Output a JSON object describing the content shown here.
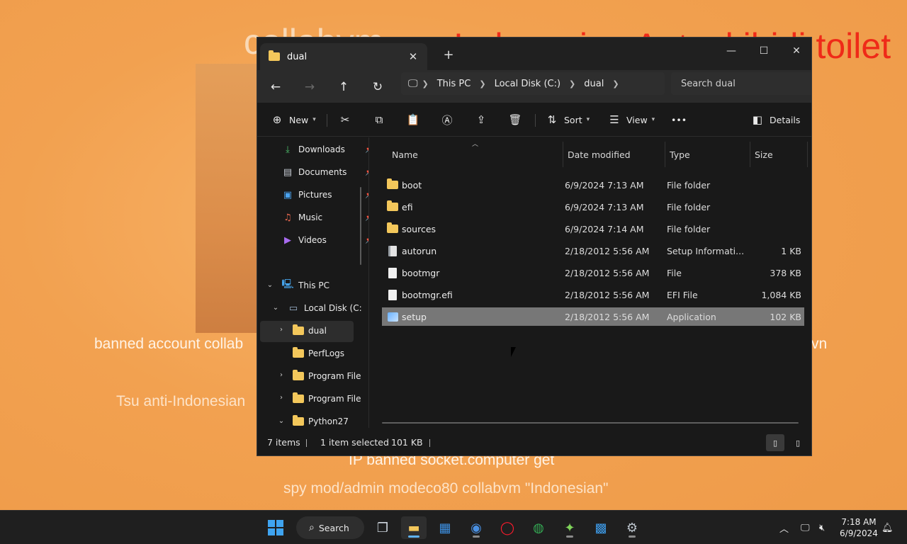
{
  "wallpaper": {
    "collabvm": "collabvm",
    "red_text": "Indonesian Autoskibidi toilet",
    "banned_line": "banned account collab",
    "vn_fragment": "vn",
    "tsu_line": "Tsu anti-Indonesian",
    "ip_line": "IP banned socket.computer get",
    "spy_line": "spy mod/admin modeco80 collabvm \"Indonesian\""
  },
  "window": {
    "tab_title": "dual",
    "tab_close": "✕",
    "new_tab": "+",
    "minimize": "—",
    "maximize": "☐",
    "close": "✕"
  },
  "nav": {
    "back": "←",
    "forward": "→",
    "up": "↑",
    "refresh": "↻",
    "breadcrumbs": [
      "This PC",
      "Local Disk (C:)",
      "dual"
    ],
    "search_placeholder": "Search dual"
  },
  "commands": {
    "new_label": "New",
    "sort_label": "Sort",
    "view_label": "View",
    "more_label": "•••",
    "details_label": "Details"
  },
  "navpane": {
    "quick": [
      {
        "label": "Downloads",
        "icon": "download-icon"
      },
      {
        "label": "Documents",
        "icon": "document-icon"
      },
      {
        "label": "Pictures",
        "icon": "pictures-icon"
      },
      {
        "label": "Music",
        "icon": "music-icon"
      },
      {
        "label": "Videos",
        "icon": "video-icon"
      }
    ],
    "this_pc": "This PC",
    "local_disk": "Local Disk (C:",
    "folders": [
      "dual",
      "PerfLogs",
      "Program File",
      "Program File",
      "Python27"
    ]
  },
  "list": {
    "headers": {
      "name": "Name",
      "date": "Date modified",
      "type": "Type",
      "size": "Size"
    },
    "rows": [
      {
        "name": "boot",
        "date": "6/9/2024 7:13 AM",
        "type": "File folder",
        "size": ""
      },
      {
        "name": "efi",
        "date": "6/9/2024 7:13 AM",
        "type": "File folder",
        "size": ""
      },
      {
        "name": "sources",
        "date": "6/9/2024 7:14 AM",
        "type": "File folder",
        "size": ""
      },
      {
        "name": "autorun",
        "date": "2/18/2012 5:56 AM",
        "type": "Setup Informati...",
        "size": "1 KB"
      },
      {
        "name": "bootmgr",
        "date": "2/18/2012 5:56 AM",
        "type": "File",
        "size": "378 KB"
      },
      {
        "name": "bootmgr.efi",
        "date": "2/18/2012 5:56 AM",
        "type": "EFI File",
        "size": "1,084 KB"
      },
      {
        "name": "setup",
        "date": "2/18/2012 5:56 AM",
        "type": "Application",
        "size": "102 KB"
      }
    ]
  },
  "status": {
    "items": "7 items",
    "selected": "1 item selected",
    "selected_size": "101 KB"
  },
  "taskbar": {
    "search_label": "Search",
    "time": "7:18 AM",
    "date": "6/9/2024"
  }
}
